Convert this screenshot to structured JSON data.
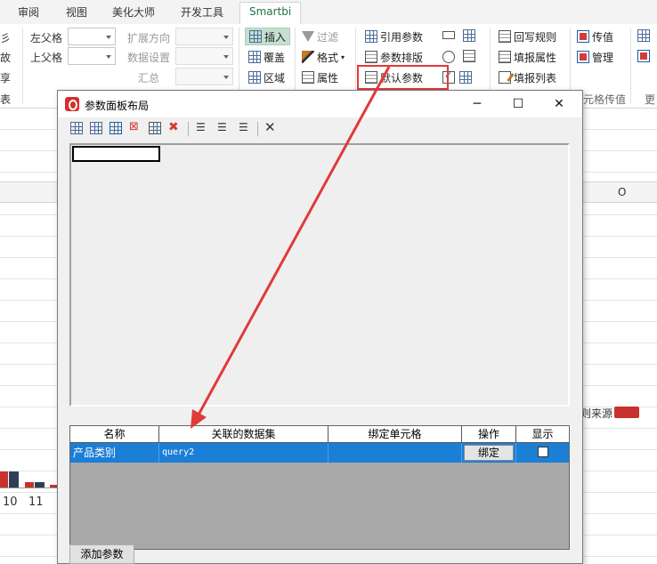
{
  "ribbon": {
    "tabs": [
      "审阅",
      "视图",
      "美化大师",
      "开发工具",
      "Smartbi"
    ],
    "left_fragments": [
      "彡",
      "故",
      "享",
      "表"
    ],
    "labels": {
      "left_parent": "左父格",
      "top_parent": "上父格",
      "expand_dir": "扩展方向",
      "data_settings": "数据设置",
      "summary": "汇总"
    },
    "buttons": {
      "insert": "插入",
      "cover": "覆盖",
      "area": "区域",
      "filter": "过滤",
      "format": "格式",
      "property": "属性",
      "ref_param": "引用参数",
      "param_layout": "参数排版",
      "default_param": "默认参数",
      "writeback_rule": "回写规则",
      "fill_property": "填报属性",
      "fill_list": "填报列表",
      "pass_value": "传值",
      "manage": "管理"
    },
    "group_label_pass": "元格传值",
    "group_label_more": "更"
  },
  "sheet": {
    "column_header": "O",
    "legend_text": "则来源",
    "axis_labels": [
      "10",
      "11"
    ],
    "legend_color": "#c8312d"
  },
  "dialog": {
    "title": "参数面板布局",
    "window_controls": {
      "minimize": "─",
      "maximize": "☐",
      "close": "✕"
    },
    "table": {
      "headers": [
        "名称",
        "关联的数据集",
        "绑定单元格",
        "操作",
        "显示"
      ],
      "rows": [
        {
          "name": "产品类别",
          "dataset": "query2",
          "cell": "",
          "action": "绑定",
          "show": false
        }
      ]
    },
    "add_button": "添加参数"
  }
}
